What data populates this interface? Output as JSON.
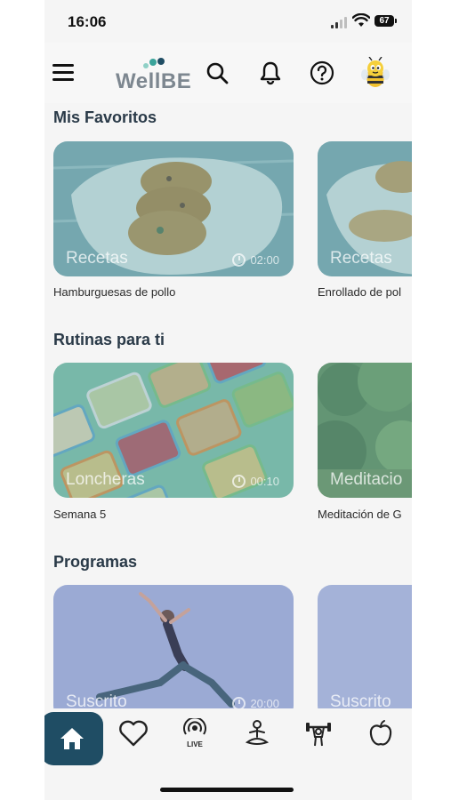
{
  "status_bar": {
    "time": "16:06",
    "battery": "67"
  },
  "header": {
    "logo_text": "WellBE"
  },
  "sections": {
    "favoritos": {
      "title": "Mis Favoritos",
      "cards": [
        {
          "label": "Recetas",
          "duration": "02:00",
          "caption": "Hamburguesas de pollo"
        },
        {
          "label": "Recetas",
          "caption": "Enrollado de pol"
        }
      ]
    },
    "rutinas": {
      "title": "Rutinas para ti",
      "cards": [
        {
          "label": "Loncheras",
          "duration": "00:10",
          "caption": "Semana 5"
        },
        {
          "label": "Meditacio",
          "caption": "Meditación de G"
        }
      ]
    },
    "programas": {
      "title": "Programas",
      "cards": [
        {
          "label": "Suscrito",
          "duration": "20:00"
        },
        {
          "label": "Suscrito"
        }
      ]
    }
  },
  "bottom_nav": {
    "items": [
      "home-icon",
      "heart-icon",
      "live-icon",
      "meditation-icon",
      "fitness-icon",
      "apple-icon"
    ],
    "live_label": "LIVE",
    "active": "home-icon"
  },
  "colors": {
    "accent": "#1f4d64",
    "logo_dots": [
      "#3aa39a",
      "#1f4d64"
    ]
  }
}
